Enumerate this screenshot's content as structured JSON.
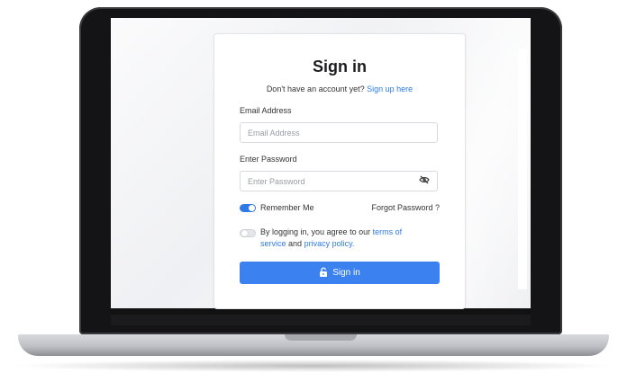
{
  "signin": {
    "title": "Sign in",
    "signup_prompt": "Don't have an account yet?",
    "signup_link": "Sign up here",
    "email_label": "Email Address",
    "email_placeholder": "Email Address",
    "email_value": "",
    "password_label": "Enter Password",
    "password_placeholder": "Enter Password",
    "password_value": "",
    "remember_label": "Remember Me",
    "remember_checked": true,
    "forgot_link": "Forgot Password ?",
    "terms_prefix": "By logging in, you agree to our",
    "terms_link_part1": "terms of",
    "terms_link_part2": "service",
    "terms_and": "and",
    "privacy_link": "privacy policy.",
    "terms_checked": false,
    "button_label": "Sign in"
  },
  "icons": {
    "password_toggle": "eye-slash-icon",
    "button": "lock-open-icon"
  },
  "colors": {
    "accent": "#2f7be5",
    "button": "#3b82f0"
  }
}
